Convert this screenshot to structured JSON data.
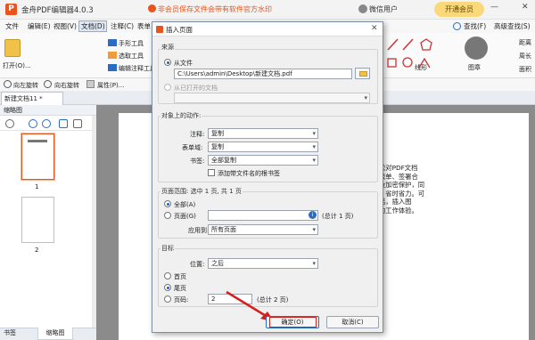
{
  "app": {
    "title": "金舟PDF编辑器4.0.3",
    "promo": "非会员保存文件会带有软件官方水印",
    "user": "微信用户",
    "vip_button": "开通会员"
  },
  "menu": {
    "items": [
      "文件",
      "编辑(E)",
      "视图(V)",
      "文档(D)",
      "注释(C)",
      "表单"
    ],
    "find": "查找(F)",
    "advanced_search": "高级查找(S)"
  },
  "toolbar": {
    "open": "打开(O)...",
    "hand_tool": "手形工具",
    "select_text": "选取工具",
    "edit_tool": "编辑注释工具",
    "line_tool": "线形",
    "stamp": "图章",
    "distance": "距离",
    "perimeter": "周长",
    "area": "面积"
  },
  "toolbar2": {
    "rotate_left": "向左旋转",
    "rotate_right": "向右旋转",
    "properties": "属性(P)..."
  },
  "tab": {
    "label": "新建文档11 *"
  },
  "left_panel": {
    "title": "缩略图",
    "pages": [
      "1",
      "2"
    ],
    "bottom_tabs": [
      "书签",
      "缩略图"
    ]
  },
  "document": {
    "text": "松对PDF文档\n表单、签署合\n及加密保护，同\n，省时省力。可\n结，插入图\n的工作体验。"
  },
  "dialog": {
    "title": "插入页面",
    "source": {
      "header": "来源",
      "from_file": "从文件",
      "file_path": "C:\\Users\\admin\\Desktop\\新建文档.pdf",
      "from_open": "从已打开的文档"
    },
    "actions": {
      "header": "对象上的动作:",
      "annotation_label": "注释:",
      "annotation_value": "复制",
      "form_label": "表单域:",
      "form_value": "复制",
      "bookmark_label": "书签:",
      "bookmark_value": "全部复制",
      "add_bookmark_checkbox": "添加带文件名的根书签"
    },
    "page_range": {
      "header": "页面范围: 选中 1 页, 共 1 页",
      "all": "全部(A)",
      "pages": "页面(G)",
      "total": "(总计 1 页)",
      "apply_label": "应用到:",
      "apply_value": "所有页面"
    },
    "target": {
      "header": "目标",
      "position_label": "位置:",
      "position_value": "之后",
      "first": "首页",
      "last": "尾页",
      "page_no": "页码:",
      "page_value": "2",
      "page_total": "(总计 2 页)"
    },
    "ok": "确定(O)",
    "cancel": "取消(C)"
  },
  "colors": {
    "accent": "#e8541e",
    "highlight": "#d61f1f",
    "link_blue": "#2b6cc4"
  }
}
